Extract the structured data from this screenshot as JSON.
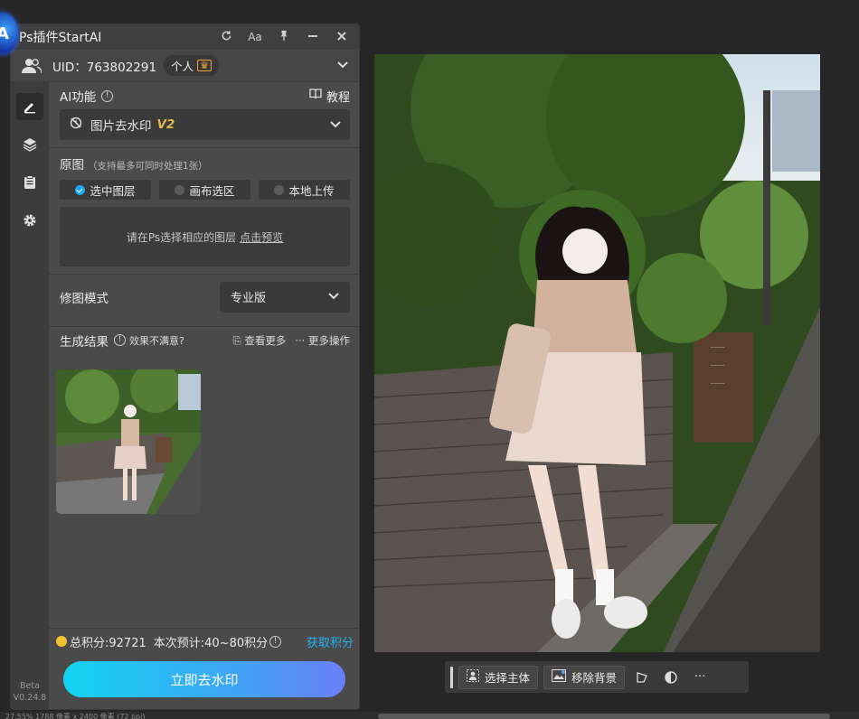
{
  "panel": {
    "title": "Ps插件StartAI",
    "logo_icon": "startai-logo-icon",
    "title_icons": [
      "refresh-icon",
      "font-size-icon",
      "pin-icon",
      "minimize-icon",
      "close-icon"
    ],
    "font_size_label": "Aa"
  },
  "user": {
    "uid_label": "UID：763802291",
    "plan": "个人"
  },
  "ai_function": {
    "label": "AI功能",
    "tutorial": "教程",
    "selected_function": "图片去水印",
    "version": "V2"
  },
  "source": {
    "label": "原图",
    "hint": "（支持最多可同时处理1张）",
    "options": [
      "选中图层",
      "画布选区",
      "本地上传"
    ],
    "selected_index": 0,
    "placeholder_text": "请在Ps选择相应的图层",
    "preview_link": "点击预览"
  },
  "retouch_mode": {
    "label": "修图模式",
    "value": "专业版"
  },
  "results": {
    "label": "生成结果",
    "not_satisfied": "效果不满意?",
    "view_more": "查看更多",
    "more_actions": "更多操作"
  },
  "credits": {
    "total": "总积分:92721",
    "estimate": "本次预计:40~80积分",
    "get_credits": "获取积分",
    "accent": "#23b2f0"
  },
  "action_button": {
    "label": "立即去水印",
    "gradient": [
      "#12d4f0",
      "#6b7ff8"
    ]
  },
  "sidebar": {
    "icons": [
      "edit-icon",
      "layers-icon",
      "clipboard-icon",
      "settings-icon"
    ],
    "active_index": 0,
    "beta_label": "Beta",
    "version": "V0.24.8"
  },
  "context_bar": {
    "select_subject": "选择主体",
    "remove_background": "移除背景",
    "extra_icons": [
      "transform-icon",
      "adjustment-icon",
      "more-icon"
    ],
    "more_label": "···"
  },
  "status": {
    "text": "27.55%   1788 像素 x 2400 像素 (72 ppi)"
  }
}
